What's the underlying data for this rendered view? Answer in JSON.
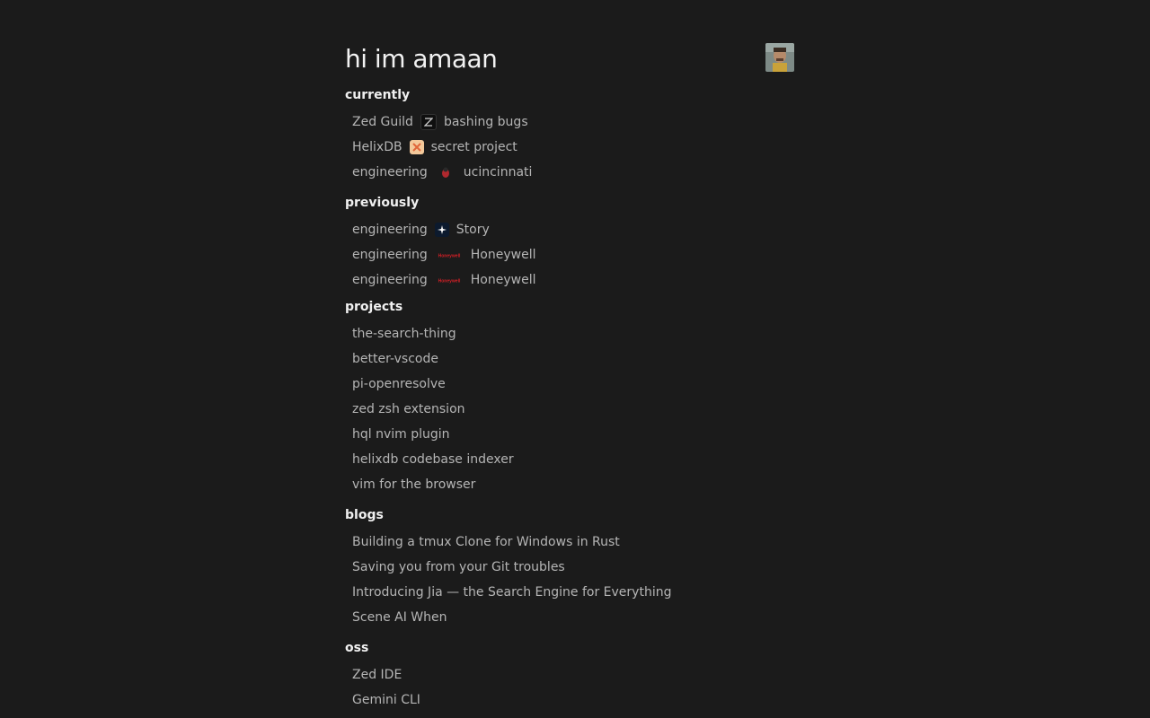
{
  "header": {
    "title": "hi im amaan"
  },
  "currently": {
    "heading": "currently",
    "items": [
      {
        "left": "Zed Guild",
        "icon": "zed-logo-icon",
        "right": "bashing bugs"
      },
      {
        "left": "HelixDB",
        "icon": "helixdb-logo-icon",
        "right": "secret project"
      },
      {
        "left": "engineering",
        "icon": "uc-bearcat-icon",
        "right": "ucincinnati"
      }
    ]
  },
  "previously": {
    "heading": "previously",
    "items": [
      {
        "left": "engineering",
        "icon": "story-logo-icon",
        "right": "Story"
      },
      {
        "left": "engineering",
        "icon": "honeywell-logo-icon",
        "right": "Honeywell",
        "logo_text": "Honeywell"
      },
      {
        "left": "engineering",
        "icon": "honeywell-logo-icon",
        "right": "Honeywell",
        "logo_text": "Honeywell"
      }
    ]
  },
  "projects": {
    "heading": "projects",
    "items": [
      "the-search-thing",
      "better-vscode",
      "pi-openresolve",
      "zed zsh extension",
      "hql nvim plugin",
      "helixdb codebase indexer",
      "vim for the browser"
    ]
  },
  "blogs": {
    "heading": "blogs",
    "items": [
      "Building a tmux Clone for Windows in Rust",
      "Saving you from your Git troubles",
      "Introducing Jia — the Search Engine for Everything",
      "Scene AI When"
    ]
  },
  "oss": {
    "heading": "oss",
    "items": [
      "Zed IDE",
      "Gemini CLI"
    ]
  },
  "colors": {
    "background": "#1b1b1b",
    "heading": "#f0f0f0",
    "item_text": "#b5b5b5",
    "honeywell_red": "#d51f26"
  }
}
